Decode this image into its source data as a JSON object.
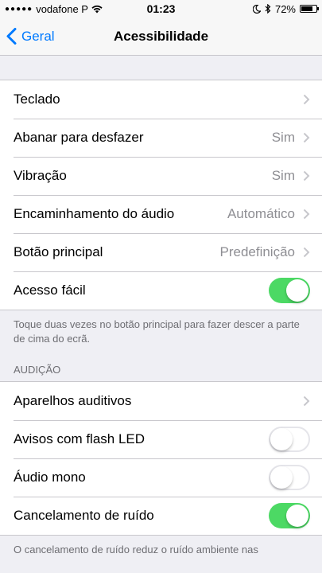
{
  "status_bar": {
    "signal_dots": "●●●●●",
    "carrier": "vodafone P",
    "time": "01:23",
    "battery_percent": "72%",
    "battery_level": 0.72
  },
  "nav": {
    "back_label": "Geral",
    "title": "Acessibilidade"
  },
  "group1": {
    "rows": [
      {
        "label": "Teclado",
        "value": ""
      },
      {
        "label": "Abanar para desfazer",
        "value": "Sim"
      },
      {
        "label": "Vibração",
        "value": "Sim"
      },
      {
        "label": "Encaminhamento do áudio",
        "value": "Automático"
      },
      {
        "label": "Botão principal",
        "value": "Predefinição"
      },
      {
        "label": "Acesso fácil",
        "toggle": true
      }
    ],
    "footer": "Toque duas vezes no botão principal para fazer descer a parte de cima do ecrã."
  },
  "hearing": {
    "header": "AUDIÇÃO",
    "rows": [
      {
        "label": "Aparelhos auditivos",
        "value": ""
      },
      {
        "label": "Avisos com flash LED",
        "toggle": false
      },
      {
        "label": "Áudio mono",
        "toggle": false
      },
      {
        "label": "Cancelamento de ruído",
        "toggle": true
      }
    ],
    "footer": "O cancelamento de ruído reduz o ruído ambiente nas"
  },
  "colors": {
    "accent": "#007aff",
    "toggle_on": "#4cd964",
    "background": "#efeff4"
  }
}
